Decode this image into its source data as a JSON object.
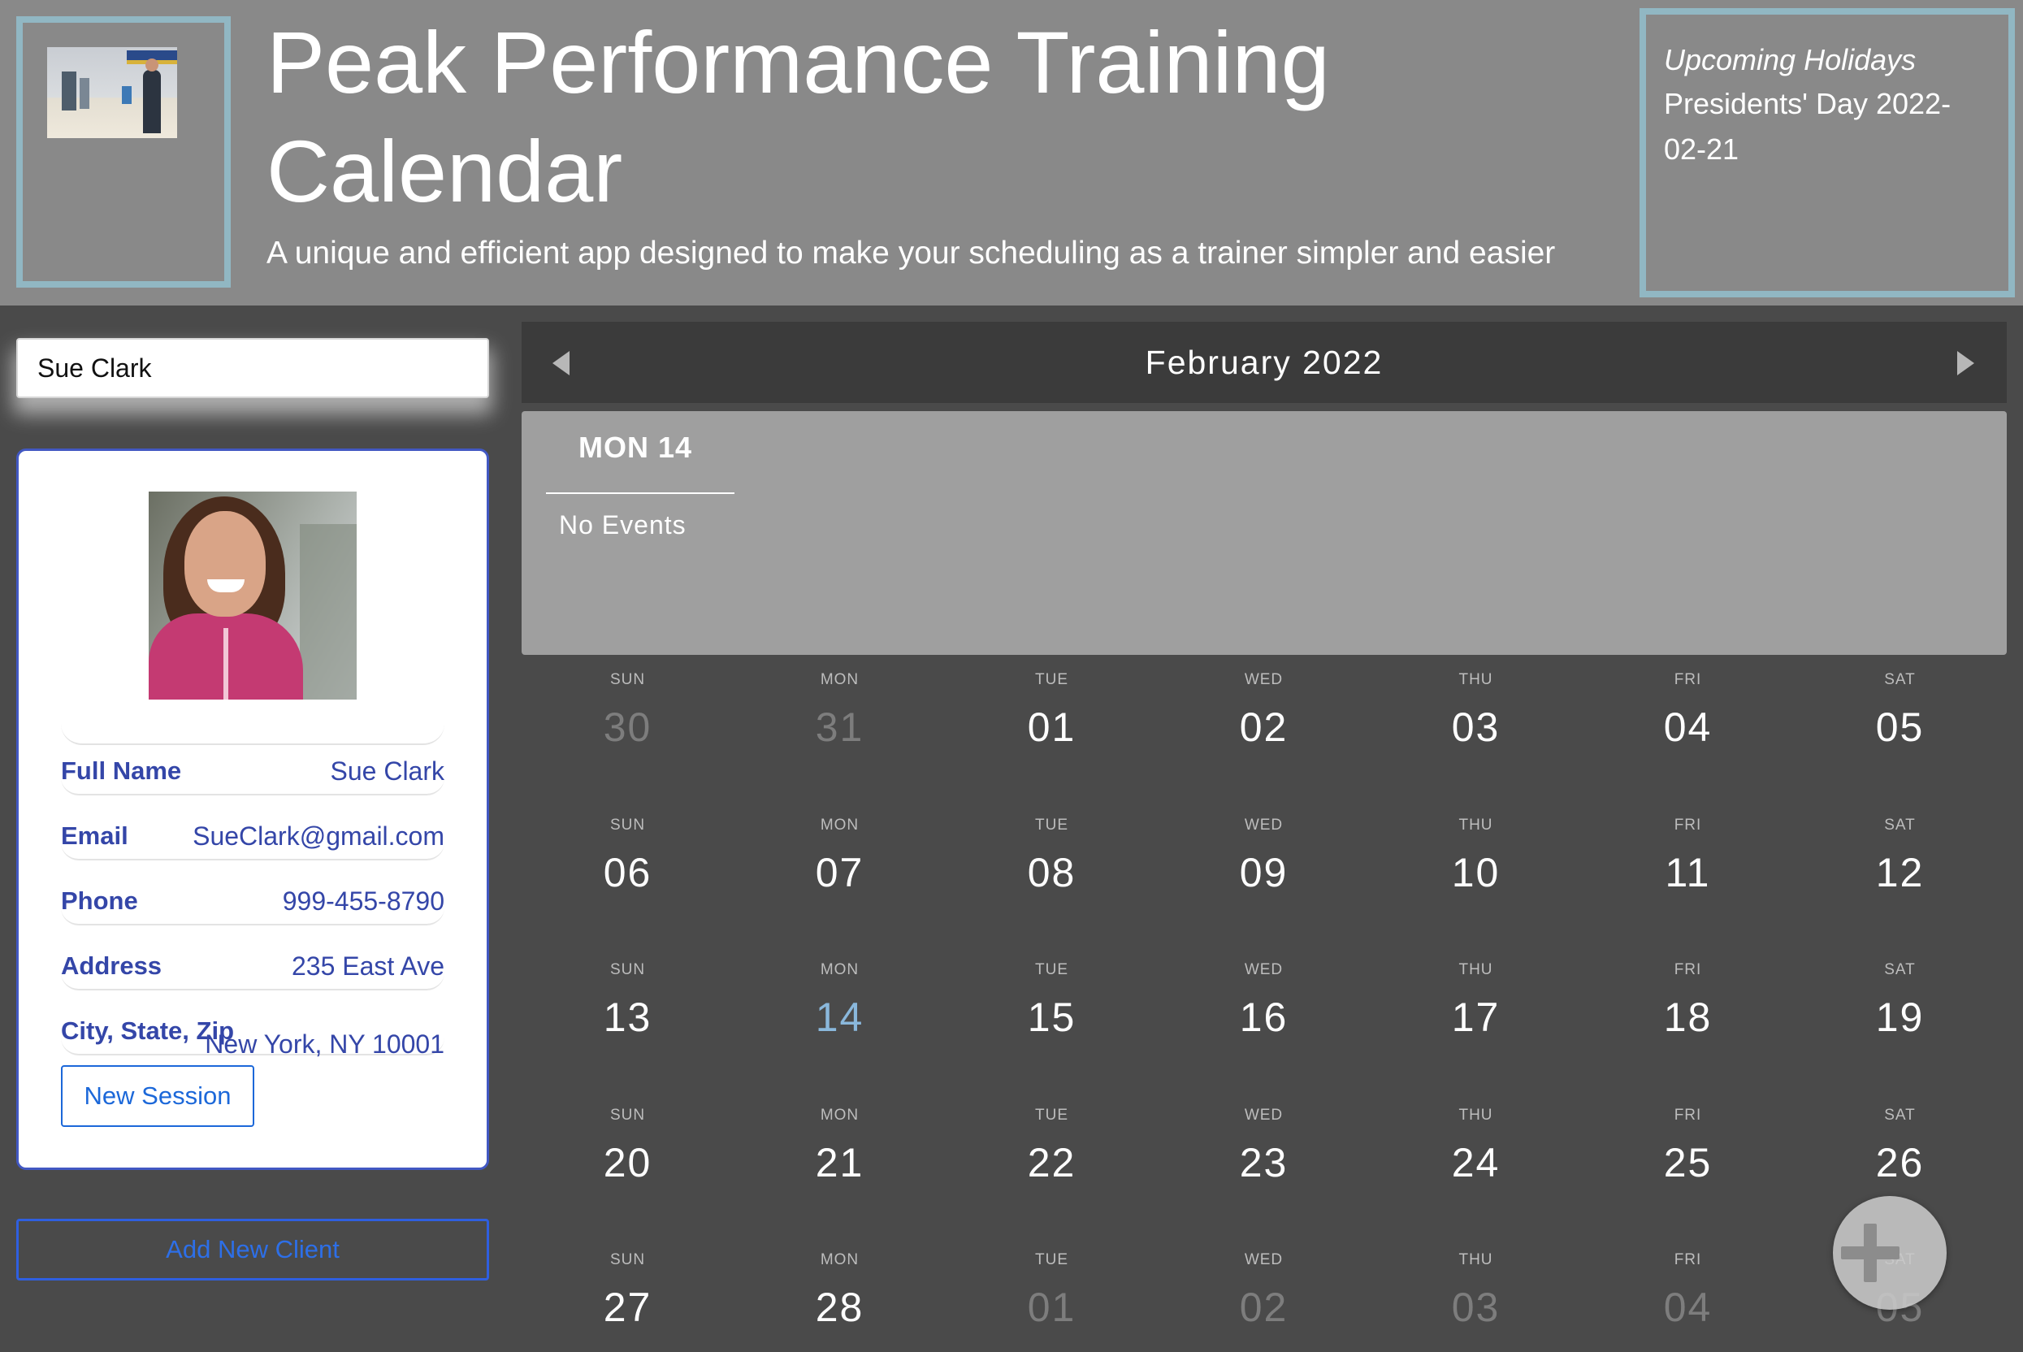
{
  "header": {
    "title": "Peak Performance Training Calendar",
    "subtitle": "A unique and efficient app designed to make your scheduling as a trainer simpler and easier",
    "holidays": {
      "title": "Upcoming Holidays",
      "items": [
        "Presidents' Day 2022-02-21"
      ]
    }
  },
  "sidebar": {
    "search": {
      "value": "Sue Clark"
    },
    "client": {
      "fields": [
        {
          "label": "Full Name",
          "value": "Sue Clark"
        },
        {
          "label": "Email",
          "value": "SueClark@gmail.com"
        },
        {
          "label": "Phone",
          "value": "999-455-8790"
        },
        {
          "label": "Address",
          "value": "235 East Ave"
        },
        {
          "label": "City, State, Zip",
          "value": "New York, NY 10001"
        }
      ],
      "new_session_label": "New Session"
    },
    "add_client_label": "Add New Client"
  },
  "calendar": {
    "month_label": "February 2022",
    "selected_day_label": "MON 14",
    "no_events_label": "No Events",
    "weekdays": [
      "SUN",
      "MON",
      "TUE",
      "WED",
      "THU",
      "FRI",
      "SAT"
    ],
    "weeks": [
      [
        {
          "d": "30",
          "muted": true
        },
        {
          "d": "31",
          "muted": true
        },
        {
          "d": "01"
        },
        {
          "d": "02"
        },
        {
          "d": "03"
        },
        {
          "d": "04"
        },
        {
          "d": "05"
        }
      ],
      [
        {
          "d": "06"
        },
        {
          "d": "07"
        },
        {
          "d": "08"
        },
        {
          "d": "09"
        },
        {
          "d": "10"
        },
        {
          "d": "11"
        },
        {
          "d": "12"
        }
      ],
      [
        {
          "d": "13"
        },
        {
          "d": "14",
          "today": true
        },
        {
          "d": "15"
        },
        {
          "d": "16"
        },
        {
          "d": "17"
        },
        {
          "d": "18"
        },
        {
          "d": "19"
        }
      ],
      [
        {
          "d": "20"
        },
        {
          "d": "21"
        },
        {
          "d": "22"
        },
        {
          "d": "23"
        },
        {
          "d": "24"
        },
        {
          "d": "25"
        },
        {
          "d": "26"
        }
      ],
      [
        {
          "d": "27"
        },
        {
          "d": "28"
        },
        {
          "d": "01",
          "muted": true
        },
        {
          "d": "02",
          "muted": true
        },
        {
          "d": "03",
          "muted": true
        },
        {
          "d": "04",
          "muted": true
        },
        {
          "d": "05",
          "muted": true
        }
      ]
    ],
    "icons": {
      "prev": "caret-left-icon",
      "next": "caret-right-icon",
      "fab": "plus-icon"
    }
  },
  "colors": {
    "header_bg": "#898989",
    "frame_accent": "#91b7c3",
    "page_bg": "#4a4a4a",
    "card_border": "#4258c2",
    "link_blue": "#1c68d9",
    "today": "#8ab8dc"
  }
}
